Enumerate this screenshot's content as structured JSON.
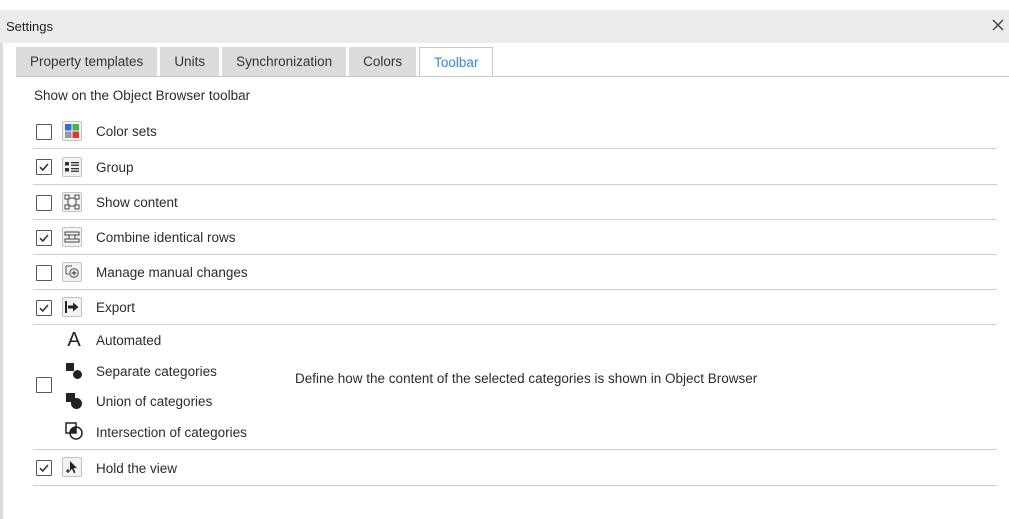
{
  "window": {
    "title": "Settings"
  },
  "tabs": [
    {
      "label": "Property templates",
      "active": false
    },
    {
      "label": "Units",
      "active": false
    },
    {
      "label": "Synchronization",
      "active": false
    },
    {
      "label": "Colors",
      "active": false
    },
    {
      "label": "Toolbar",
      "active": true
    }
  ],
  "section": {
    "title": "Show on the Object Browser toolbar"
  },
  "options": [
    {
      "label": "Color sets",
      "checked": false,
      "icon": "color-sets-icon"
    },
    {
      "label": "Group",
      "checked": true,
      "icon": "group-icon"
    },
    {
      "label": "Show content",
      "checked": false,
      "icon": "show-content-icon"
    },
    {
      "label": "Combine identical rows",
      "checked": true,
      "icon": "combine-rows-icon"
    },
    {
      "label": "Manage manual changes",
      "checked": false,
      "icon": "manage-changes-icon"
    },
    {
      "label": "Export",
      "checked": true,
      "icon": "export-icon"
    }
  ],
  "categories_option": {
    "checked": false,
    "items": [
      {
        "label": "Automated",
        "icon": "automated-icon"
      },
      {
        "label": "Separate categories",
        "icon": "separate-categories-icon"
      },
      {
        "label": "Union of categories",
        "icon": "union-categories-icon"
      },
      {
        "label": "Intersection of categories",
        "icon": "intersection-categories-icon"
      }
    ],
    "description": "Define how the content of the selected categories is shown in Object Browser"
  },
  "hold_option": {
    "label": "Hold the view",
    "checked": true,
    "icon": "hold-view-icon"
  },
  "colors": {
    "accent": "#2e8bd8",
    "title_bar": "#ececec",
    "tab_bg": "#dcdcdc",
    "divider": "#cfcfcf"
  }
}
